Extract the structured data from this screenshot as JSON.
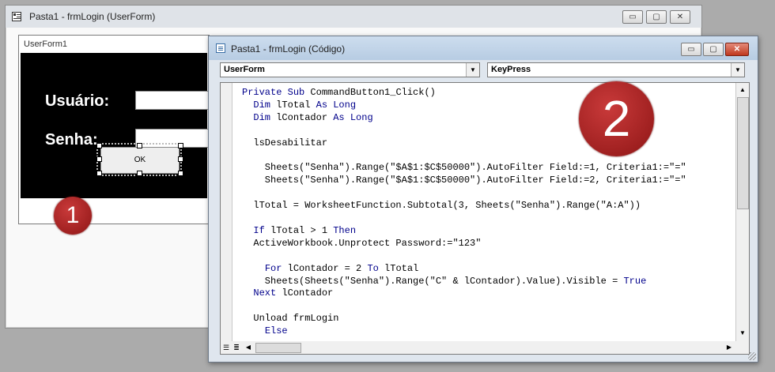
{
  "back_window": {
    "title": "Pasta1 - frmLogin (UserForm)",
    "controls": {
      "minimize": "▭",
      "maximize": "▢",
      "close": "✕"
    }
  },
  "userform": {
    "title": "UserForm1",
    "usuario_label": "Usuário:",
    "senha_label": "Senha:",
    "ok_label": "OK",
    "badge": "1"
  },
  "code_window": {
    "title": "Pasta1 - frmLogin (Código)",
    "controls": {
      "minimize": "▭",
      "maximize": "▢",
      "close": "✕"
    },
    "object_combo": "UserForm",
    "procedure_combo": "KeyPress",
    "badge": "2"
  },
  "code": [
    "Private Sub CommandButton1_Click()",
    "  Dim lTotal As Long",
    "  Dim lContador As Long",
    "",
    "  lsDesabilitar",
    "",
    "    Sheets(\"Senha\").Range(\"$A$1:$C$50000\").AutoFilter Field:=1, Criteria1:=\"=\"",
    "    Sheets(\"Senha\").Range(\"$A$1:$C$50000\").AutoFilter Field:=2, Criteria1:=\"=\"",
    "",
    "  lTotal = WorksheetFunction.Subtotal(3, Sheets(\"Senha\").Range(\"A:A\"))",
    "",
    "  If lTotal > 1 Then",
    "  ActiveWorkbook.Unprotect Password:=\"123\"",
    "",
    "    For lContador = 2 To lTotal",
    "    Sheets(Sheets(\"Senha\").Range(\"C\" & lContador).Value).Visible = True",
    "  Next lContador",
    "",
    "  Unload frmLogin",
    "    Else"
  ],
  "scroll": {
    "up": "▲",
    "down": "▼",
    "left": "◀",
    "right": "▶"
  },
  "view_buttons": {
    "procedure_view": "☰",
    "full_module_view": "≣"
  }
}
